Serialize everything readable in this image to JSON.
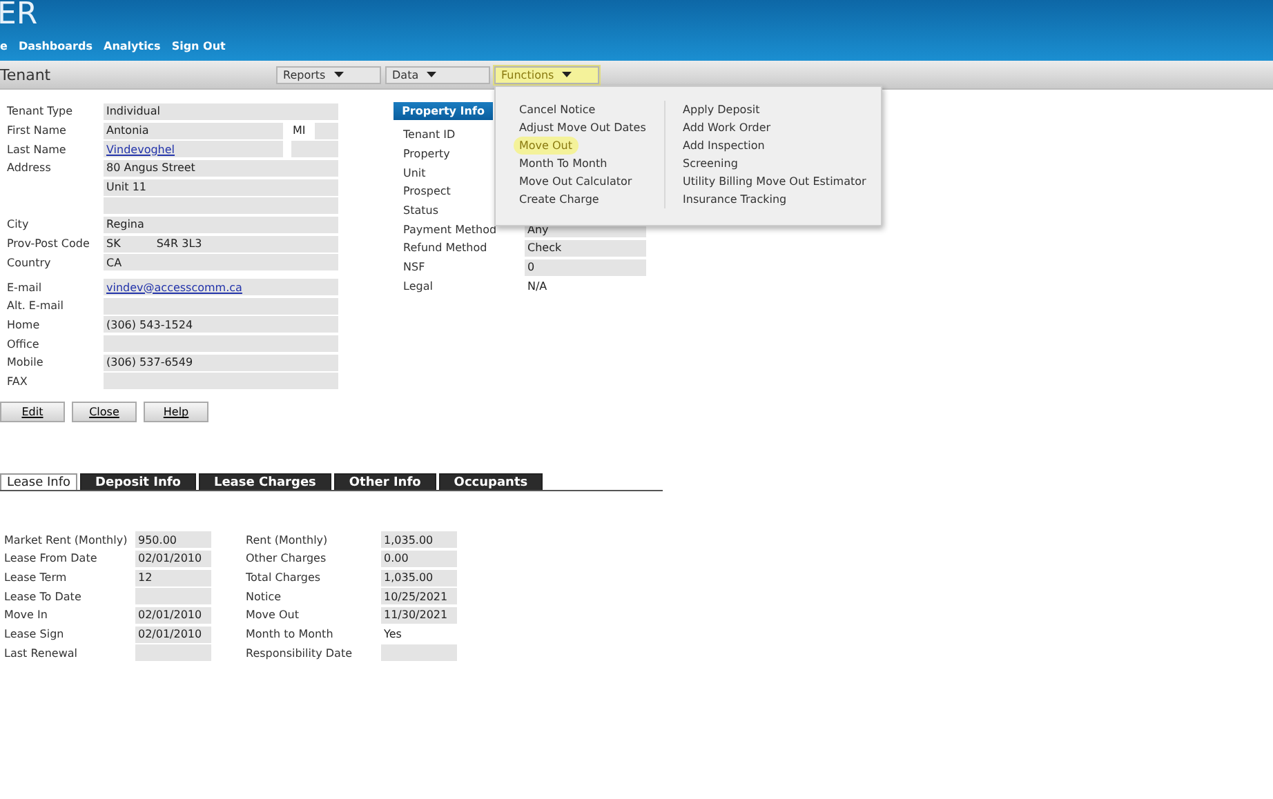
{
  "header": {
    "logo": "ER",
    "nav": [
      "e",
      "Dashboards",
      "Analytics",
      "Sign Out"
    ]
  },
  "title_bar": {
    "title": "Tenant",
    "menus": [
      {
        "label": "Reports",
        "highlighted": false,
        "open": false
      },
      {
        "label": "Data",
        "highlighted": false,
        "open": false
      },
      {
        "label": "Functions",
        "highlighted": true,
        "open": true
      }
    ]
  },
  "functions_menu": {
    "columns": [
      [
        {
          "label": "Cancel Notice",
          "highlighted": false
        },
        {
          "label": "Adjust Move Out Dates",
          "highlighted": false
        },
        {
          "label": "Move Out",
          "highlighted": true
        },
        {
          "label": "Month To Month",
          "highlighted": false
        },
        {
          "label": "Move Out Calculator",
          "highlighted": false
        },
        {
          "label": "Create Charge",
          "highlighted": false
        }
      ],
      [
        {
          "label": "Apply Deposit",
          "highlighted": false
        },
        {
          "label": "Add Work Order",
          "highlighted": false
        },
        {
          "label": "Add Inspection",
          "highlighted": false
        },
        {
          "label": "Screening",
          "highlighted": false
        },
        {
          "label": "Utility Billing Move Out Estimator",
          "highlighted": false
        },
        {
          "label": "Insurance Tracking",
          "highlighted": false
        }
      ]
    ]
  },
  "tenant_form": [
    {
      "kind": "field",
      "label": "Tenant Type",
      "value": "Individual"
    },
    {
      "kind": "side",
      "label": "First Name",
      "value": "Antonia",
      "side_label": "MI"
    },
    {
      "kind": "side",
      "label": "Last Name",
      "value": "Vindevoghel",
      "link": true
    },
    {
      "kind": "field",
      "label": "Address",
      "value": "80 Angus Street"
    },
    {
      "kind": "field",
      "value": "Unit 11"
    },
    {
      "kind": "field"
    },
    {
      "kind": "field",
      "label": "City",
      "value": "Regina"
    },
    {
      "kind": "split",
      "label": "Prov-Post Code",
      "value": "SK",
      "value2": "S4R 3L3"
    },
    {
      "kind": "field",
      "label": "Country",
      "value": "CA"
    },
    {
      "kind": "field",
      "label": "E-mail",
      "value": "vindev@accesscomm.ca",
      "link": true,
      "gap_before": true
    },
    {
      "kind": "field",
      "label": "Alt. E-mail"
    },
    {
      "kind": "field",
      "label": "Home",
      "value": "(306) 543-1524"
    },
    {
      "kind": "field",
      "label": "Office"
    },
    {
      "kind": "field",
      "label": "Mobile",
      "value": "(306) 537-6549"
    },
    {
      "kind": "field",
      "label": "FAX"
    }
  ],
  "buttons": [
    "Edit",
    "Close",
    "Help"
  ],
  "property_info": {
    "header": "Property Info",
    "rows": [
      {
        "label": "Tenant ID"
      },
      {
        "label": "Property"
      },
      {
        "label": "Unit"
      },
      {
        "label": "Prospect"
      },
      {
        "label": "Status"
      },
      {
        "label": "Payment Method",
        "value": "Any",
        "boxed": true
      },
      {
        "label": "Refund Method",
        "value": "Check",
        "boxed": true
      },
      {
        "label": "NSF",
        "value": "0",
        "boxed": true
      },
      {
        "label": "Legal",
        "value": "N/A",
        "boxed": false
      }
    ]
  },
  "tabs": [
    {
      "label": "Lease Info",
      "selected": true
    },
    {
      "label": "Deposit Info",
      "selected": false
    },
    {
      "label": "Lease Charges",
      "selected": false
    },
    {
      "label": "Other Info",
      "selected": false
    },
    {
      "label": "Occupants",
      "selected": false
    }
  ],
  "lease_info": [
    {
      "label": "Market Rent (Monthly)",
      "value": "950.00",
      "label2": "Rent (Monthly)",
      "value2": "1,035.00",
      "boxed2": true
    },
    {
      "label": "Lease From Date",
      "value": "02/01/2010",
      "label2": "Other Charges",
      "value2": "0.00",
      "boxed2": true
    },
    {
      "label": "Lease Term",
      "value": "12",
      "label2": "Total Charges",
      "value2": "1,035.00",
      "boxed2": true
    },
    {
      "label": "Lease To Date",
      "label2": "Notice",
      "value2": "10/25/2021",
      "boxed2": true
    },
    {
      "label": "Move In",
      "value": "02/01/2010",
      "label2": "Move Out",
      "value2": "11/30/2021",
      "boxed2": true
    },
    {
      "label": "Lease Sign",
      "value": "02/01/2010",
      "label2": "Month to Month",
      "value2": "Yes",
      "boxed2": false
    },
    {
      "label": "Last Renewal",
      "label2": "Responsibility Date",
      "boxed2": true
    }
  ]
}
